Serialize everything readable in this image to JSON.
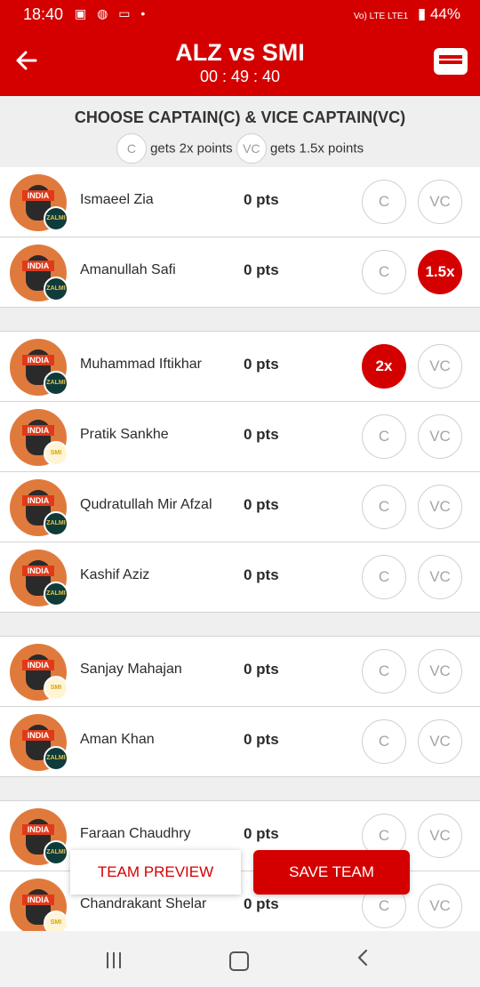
{
  "status_bar": {
    "time": "18:40",
    "network": "Vo) LTE LTE1",
    "battery": "44%"
  },
  "header": {
    "title": "ALZ vs SMI",
    "timer": "00 : 49 : 40"
  },
  "choose": {
    "heading": "CHOOSE CAPTAIN(C) & VICE CAPTAIN(VC)",
    "c_symbol": "C",
    "c_hint": "gets 2x points",
    "vc_symbol": "VC",
    "vc_hint": "gets 1.5x points"
  },
  "players": [
    {
      "name": "Ismaeel Zia",
      "pts": "0 pts",
      "c": "C",
      "vc": "VC",
      "avatar_text": "INDIA",
      "team_badge": "ZALMI"
    },
    {
      "name": "Amanullah Safi",
      "pts": "0 pts",
      "c": "C",
      "vc": "1.5x",
      "avatar_text": "INDIA",
      "team_badge": "ZALMI"
    },
    {
      "name": "Muhammad Iftikhar",
      "pts": "0 pts",
      "c": "2x",
      "vc": "VC",
      "avatar_text": "INDIA",
      "team_badge": "ZALMI"
    },
    {
      "name": "Pratik Sankhe",
      "pts": "0 pts",
      "c": "C",
      "vc": "VC",
      "avatar_text": "INDIA",
      "team_badge": "SMI"
    },
    {
      "name": "Qudratullah Mir Afzal",
      "pts": "0 pts",
      "c": "C",
      "vc": "VC",
      "avatar_text": "INDIA",
      "team_badge": "ZALMI"
    },
    {
      "name": "Kashif Aziz",
      "pts": "0 pts",
      "c": "C",
      "vc": "VC",
      "avatar_text": "INDIA",
      "team_badge": "ZALMI"
    },
    {
      "name": "Sanjay Mahajan",
      "pts": "0 pts",
      "c": "C",
      "vc": "VC",
      "avatar_text": "INDIA",
      "team_badge": "SMI"
    },
    {
      "name": "Aman Khan",
      "pts": "0 pts",
      "c": "C",
      "vc": "VC",
      "avatar_text": "INDIA",
      "team_badge": "ZALMI"
    },
    {
      "name": "Faraan Chaudhry",
      "pts": "0 pts",
      "c": "C",
      "vc": "VC",
      "avatar_text": "INDIA",
      "team_badge": "ZALMI"
    },
    {
      "name": "Chandrakant Shelar",
      "pts": "0 pts",
      "c": "C",
      "vc": "VC",
      "avatar_text": "INDIA",
      "team_badge": "SMI"
    }
  ],
  "actions": {
    "team_preview": "TEAM PREVIEW",
    "save_team": "SAVE TEAM"
  },
  "colors": {
    "brand_red": "#d40000",
    "section_gray": "#efefef"
  }
}
